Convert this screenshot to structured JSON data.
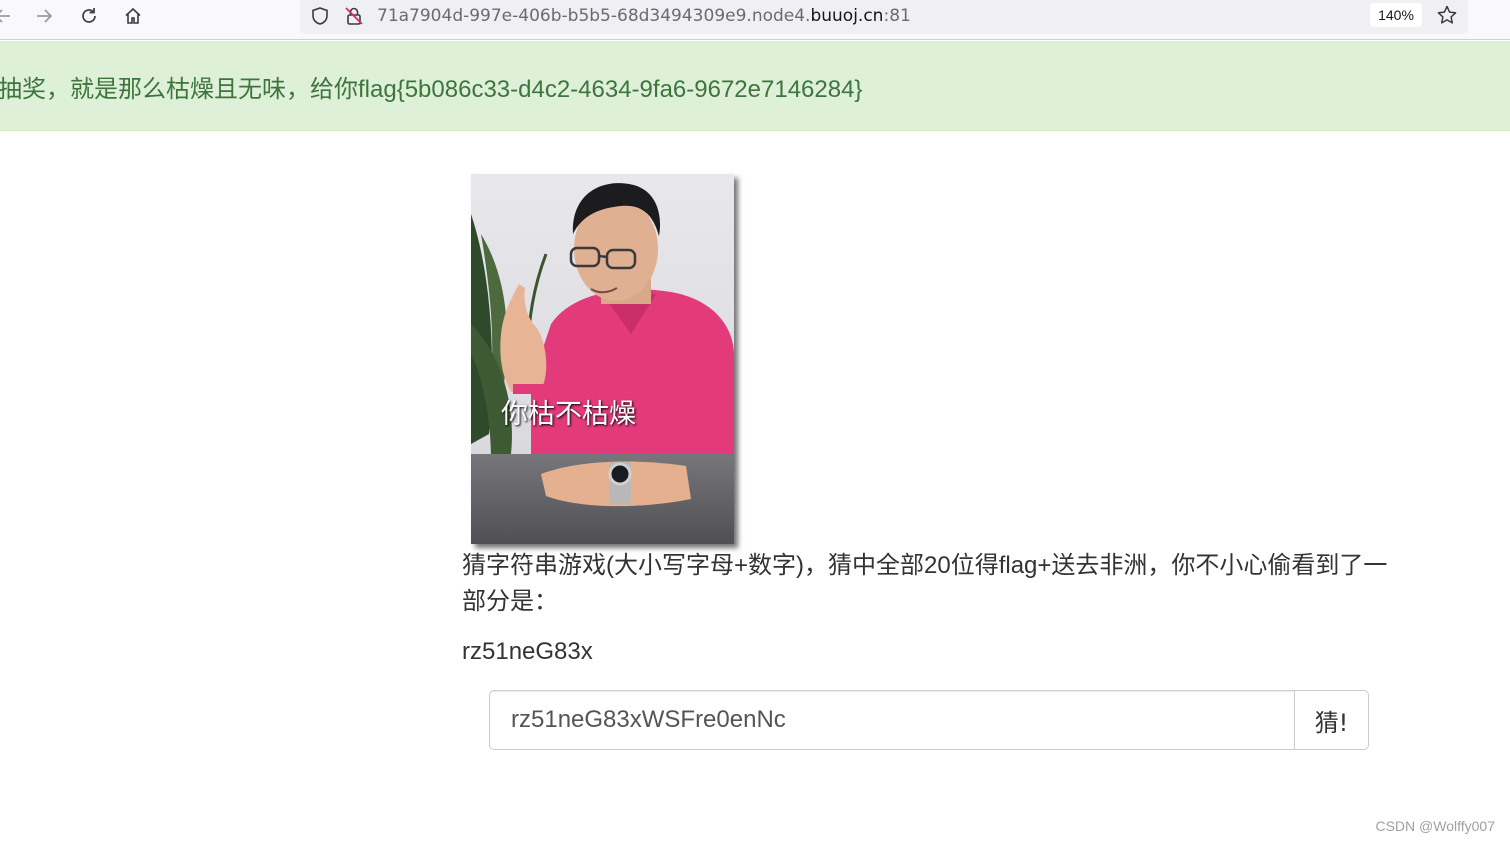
{
  "browser": {
    "url_prefix": "71a7904d-997e-406b-b5b5-68d3494309e9.node4.",
    "url_domain": "buuoj.cn",
    "url_port": ":81",
    "zoom": "140%",
    "icons": [
      "back-icon",
      "forward-icon",
      "reload-icon",
      "home-icon",
      "shield-icon",
      "insecure-lock-icon",
      "star-icon"
    ]
  },
  "alert": {
    "text": "抽奖，就是那么枯燥且无味，给你flag{5b086c33-d4c2-4634-9fa6-9672e7146284}",
    "color": "#3c763d",
    "background": "#dff0d8"
  },
  "meme": {
    "caption": "你枯不枯燥"
  },
  "game": {
    "prompt": "猜字符串游戏(大小写字母+数字)，猜中全部20位得flag+送去非洲，你不小心偷看到了一部分是：",
    "partial": "rz51neG83x",
    "input_value": "rz51neG83xWSFre0enNc",
    "button_label": "猜!"
  },
  "watermark": "CSDN @Wolffy007"
}
